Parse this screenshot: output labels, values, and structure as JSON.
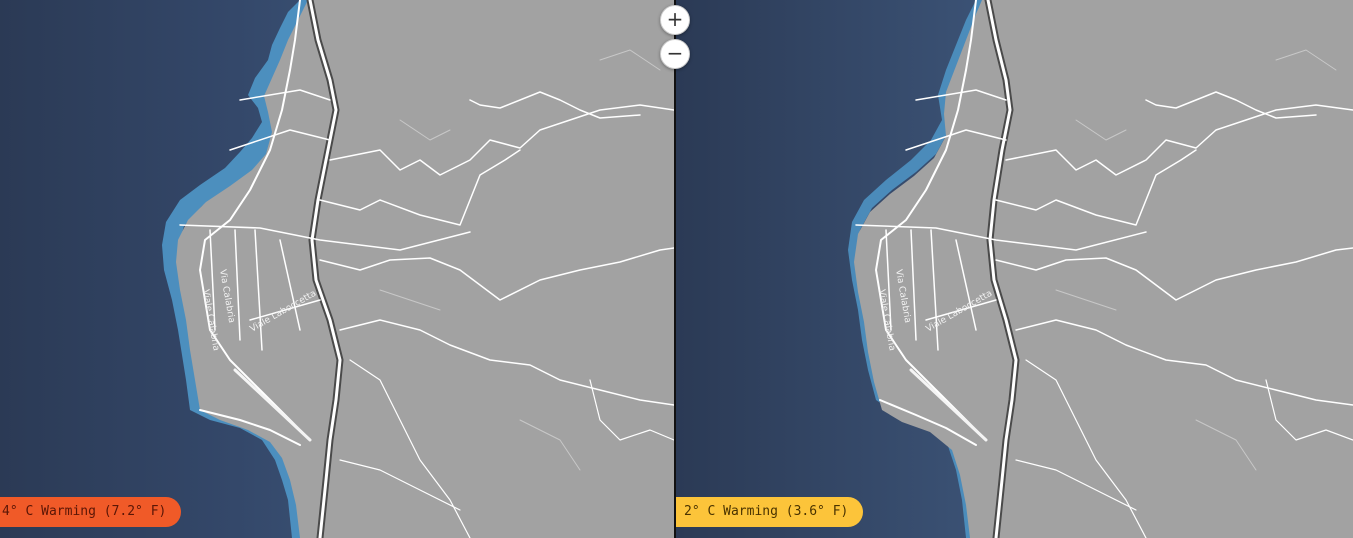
{
  "map": {
    "left_scenario": {
      "label": "4° C Warming (7.2° F)",
      "color": "#f05a28"
    },
    "right_scenario": {
      "label": "2° C Warming (3.6° F)",
      "color": "#fcc43a"
    },
    "zoom_in_label": "+",
    "zoom_out_label": "−",
    "streets": [
      "Viale Calabria",
      "Via Calabria",
      "Viale Laboccetta"
    ],
    "colors": {
      "land": "#a2a2a2",
      "water": "#2f3f5b",
      "flooded": "#4f97c8",
      "roads": "#ffffff"
    }
  }
}
